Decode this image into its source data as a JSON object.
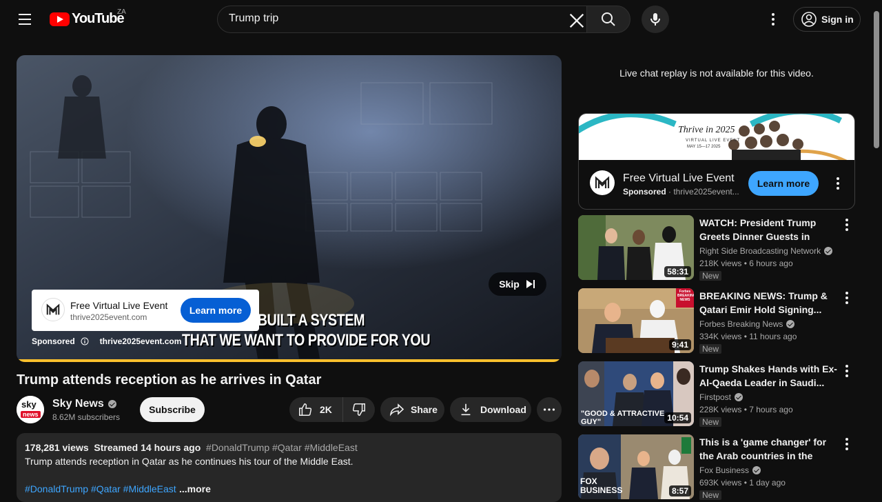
{
  "header": {
    "logo_text": "YouTube",
    "country_code": "ZA",
    "search_value": "Trump trip",
    "sign_in_label": "Sign in"
  },
  "player": {
    "ad_card": {
      "title": "Free Virtual Live Event",
      "url": "thrive2025event.com",
      "button_label": "Learn more"
    },
    "skip_label": "Skip",
    "sponsored_label": "Sponsored",
    "sponsored_url": "thrive2025event.com",
    "caption_line1": "WE BUILT A SYSTEM",
    "caption_line2": "THAT WE WANT TO PROVIDE FOR YOU",
    "progress_fraction": 1.0,
    "progress_color": "#fbc02d"
  },
  "video": {
    "title": "Trump attends reception as he arrives in Qatar",
    "channel_name": "Sky News",
    "avatar_text_top": "sky",
    "avatar_text_bottom": "news",
    "subscribers": "8.62M subscribers",
    "subscribe_label": "Subscribe",
    "likes": "2K",
    "share_label": "Share",
    "download_label": "Download",
    "description": {
      "views": "178,281 views",
      "streamed": "Streamed 14 hours ago",
      "tags": "#DonaldTrump #Qatar #MiddleEast",
      "text": "Trump attends reception in Qatar as he continues his tour of the Middle East.",
      "links": "#DonaldTrump #Qatar #MiddleEast",
      "more_label": "...more"
    }
  },
  "sidebar": {
    "chat_note": "Live chat replay is not available for this video.",
    "ad": {
      "banner_title": "Thrive in 2025",
      "banner_subtitle": "VIRTUAL LIVE EVENT",
      "banner_date": "MAY 15—17 2025",
      "title": "Free Virtual Live Event",
      "sponsored": "Sponsored",
      "url": "thrive2025event...",
      "button_label": "Learn more"
    },
    "recommendations": [
      {
        "title": "WATCH: President Trump Greets Dinner Guests in Doha,...",
        "channel": "Right Side Broadcasting Network",
        "meta": "218K views • 6 hours ago",
        "badge": "New",
        "duration": "58:31",
        "thumb_color": "#6e7f5a"
      },
      {
        "title": "BREAKING NEWS: Trump & Qatari Emir Hold Signing...",
        "channel": "Forbes Breaking News",
        "meta": "334K views • 11 hours ago",
        "badge": "New",
        "duration": "9:41",
        "thumb_color": "#a88a5e",
        "overlay": "Forbes BREAKING NEWS"
      },
      {
        "title": "Trump Shakes Hands with Ex-Al-Qaeda Leader in Saudi...",
        "channel": "Firstpost",
        "meta": "228K views • 7 hours ago",
        "badge": "New",
        "duration": "10:54",
        "thumb_color": "#2f4a7a",
        "overlay": "\"GOOD & ATTRACTIVE GUY\""
      },
      {
        "title": "This is a 'game changer' for the Arab countries in the Middle...",
        "channel": "Fox Business",
        "meta": "693K views • 1 day ago",
        "badge": "New",
        "duration": "8:57",
        "thumb_color": "#8a7d6a",
        "overlay": "FOX BUSINESS"
      }
    ]
  }
}
